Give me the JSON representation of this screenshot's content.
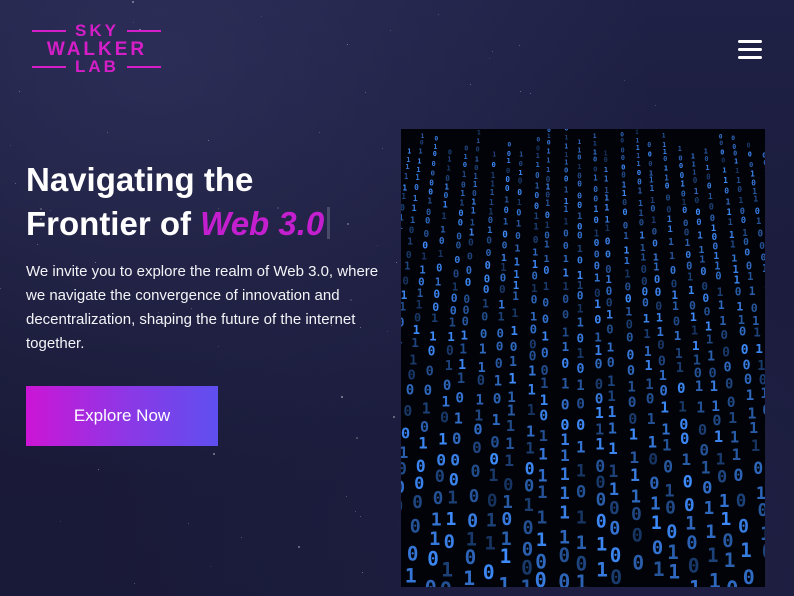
{
  "brand": {
    "logo_line1": "SKY",
    "logo_line2": "WALKER",
    "logo_line3": "LAB",
    "color": "#d61ec8"
  },
  "nav": {
    "menu_icon": "hamburger-menu-icon"
  },
  "hero": {
    "title_line1": "Navigating the",
    "title_line2": "Frontier of",
    "title_accent": "Web 3.0",
    "description": "We invite you to explore the realm of Web 3.0, where we navigate the convergence of innovation and decentralization, shaping the future of the internet together.",
    "cta_label": "Explore Now",
    "accent_color": "#c31fcf"
  },
  "media": {
    "illustration": "binary-code-rain-image"
  },
  "colors": {
    "background": "#1b1c3c",
    "cta_gradient_start": "#cc15d5",
    "cta_gradient_end": "#5f4ff0",
    "binary_glyphs": "#3f8dff"
  }
}
